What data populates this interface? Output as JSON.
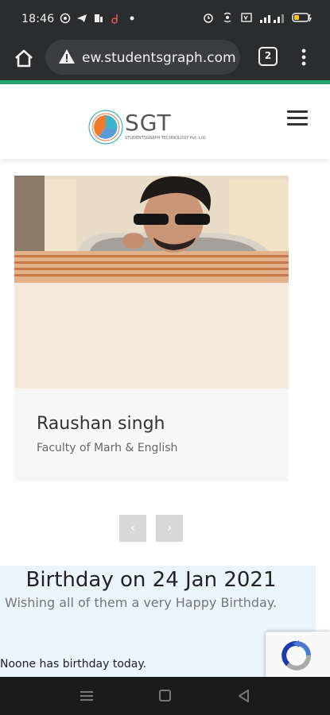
{
  "status_bar": {
    "time": "18:46",
    "left_icons": [
      "whatsapp-icon",
      "telegram-icon",
      "news-icon",
      "tiktok-icon",
      "dot-icon"
    ],
    "right_icons": [
      "alarm-icon",
      "wifi-hotspot-icon",
      "volte-icon",
      "signal-icon",
      "battery-icon"
    ]
  },
  "browser": {
    "url": "ew.studentsgraph.com",
    "tab_count": "2"
  },
  "site": {
    "logo_text": "SGT",
    "logo_sub": "STUDENTSGRAPH TECHNOLOGY Pvt. Ltd."
  },
  "card": {
    "name": "Raushan singh",
    "role": "Faculty of Marh & English"
  },
  "carousel": {
    "prev": "‹",
    "next": "›"
  },
  "birthday": {
    "title": "Birthday on 24 Jan 2021",
    "subtitle": "Wishing all of them a very Happy Birthday.",
    "empty_message": "Noone has birthday today."
  },
  "colors": {
    "accent": "#24a56f",
    "birthday_bg": "#e9f4fb"
  }
}
